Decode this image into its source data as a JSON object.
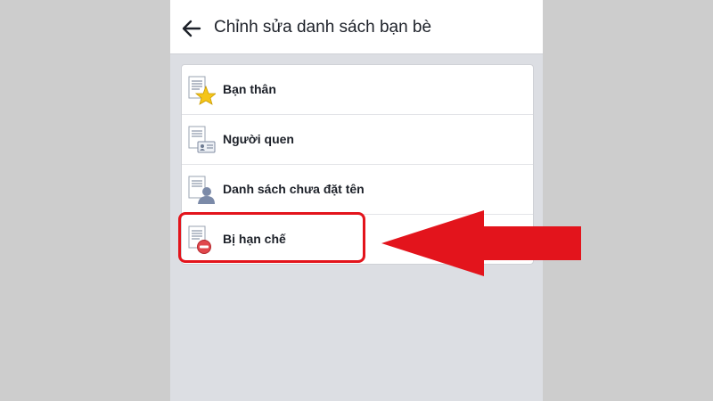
{
  "header": {
    "title": "Chỉnh sửa danh sách bạn bè",
    "back_icon": "arrow-left-icon"
  },
  "lists": [
    {
      "label": "Bạn thân",
      "icon": "document-star-icon"
    },
    {
      "label": "Người quen",
      "icon": "document-id-card-icon"
    },
    {
      "label": "Danh sách chưa đặt tên",
      "icon": "document-person-icon"
    },
    {
      "label": "Bị hạn chế",
      "icon": "document-restricted-icon"
    }
  ],
  "annotation": {
    "highlight_color": "#e3141c",
    "highlighted_item": "Bị hạn chế"
  },
  "colors": {
    "header_bg": "#ffffff",
    "page_bg": "#dcdee3",
    "outside_bg": "#cdcdcd",
    "text": "#1d2129"
  }
}
